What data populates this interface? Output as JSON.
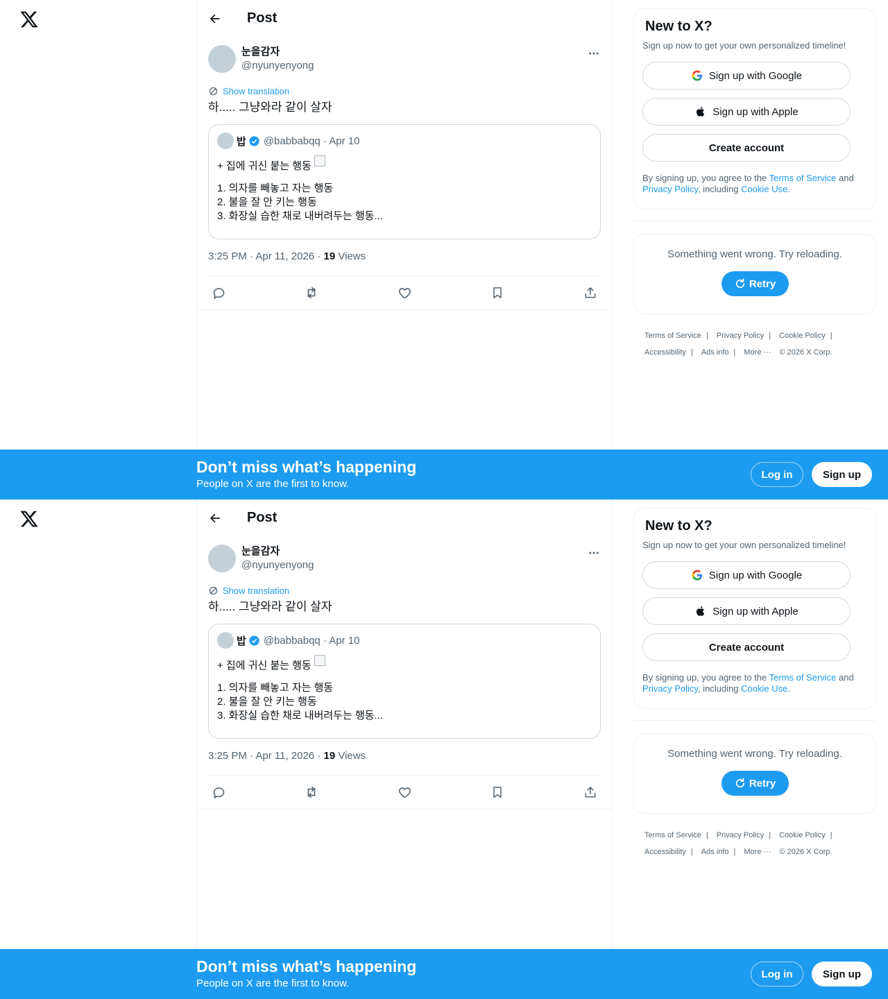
{
  "topbar": {
    "title": "Post"
  },
  "post": {
    "author_name": "눈을감자",
    "author_handle": "@nyunyenyong",
    "translate_label": "Show translation",
    "text": "하..... 그냥와라 같이 살자",
    "timestamp": "3:25 PM · Apr 11, 2026 · ",
    "views_count": "19",
    "views_label": " Views"
  },
  "quote": {
    "name": "밥",
    "handle_date": "@babbabqq · Apr 10",
    "line1": "+ 집에 귀신 붙는 행동",
    "line2": "1. 의자를 빼놓고 자는 행동",
    "line3": "2. 불을 잘 안 키는 행동",
    "line4": "3. 화장실 습한 채로 내버려두는 행동..."
  },
  "sidebar": {
    "title": "New to X?",
    "subtitle": "Sign up now to get your own personalized timeline!",
    "google_label": "Sign up with Google",
    "apple_label": "Sign up with Apple",
    "create_label": "Create account",
    "legal_prefix": "By signing up, you agree to the ",
    "tos": "Terms of Service",
    "and": " and",
    "privacy": "Privacy Policy",
    "including": ", including ",
    "cookie": "Cookie Use."
  },
  "error": {
    "text": "Something went wrong. Try reloading.",
    "retry": "Retry"
  },
  "footer": {
    "tos": "Terms of Service",
    "privacy": "Privacy Policy",
    "cookie": "Cookie Policy",
    "accessibility": "Accessibility",
    "ads": "Ads info",
    "more": "More ···",
    "copyright": "© 2026 X Corp."
  },
  "banner": {
    "title": "Don’t miss what’s happening",
    "subtitle": "People on X are the first to know.",
    "login": "Log in",
    "signup": "Sign up"
  },
  "colors": {
    "accent": "#1d9bf0",
    "text": "#0f1419",
    "muted": "#536471"
  }
}
